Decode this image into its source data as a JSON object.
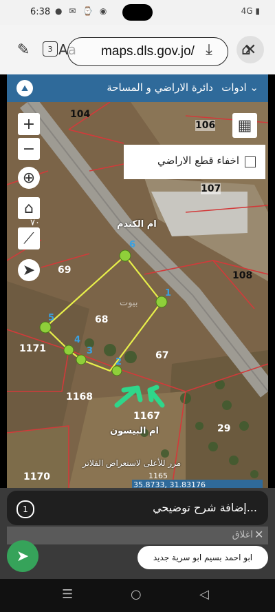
{
  "status": {
    "time": "6:38",
    "icons": "● ✉ ⌚ ◉",
    "right": "4G ▮"
  },
  "toolbar": {
    "url": "maps.dls.gov.jo/",
    "text_size_label": "Aa",
    "tab_count": "3"
  },
  "header": {
    "title": "دائرة الاراضي و المساحة",
    "tools": "ادوات ⌄"
  },
  "map": {
    "hide_parcels_label": "اخفاء قطع الاراضي",
    "parcels": [
      "104",
      "106",
      "107",
      "108",
      "69",
      "68",
      "67",
      "1171",
      "1168",
      "1167",
      "29",
      "1170",
      "٧٠"
    ],
    "vertices": [
      "1",
      "2",
      "3",
      "4",
      "5",
      "6"
    ],
    "streets": [
      "ام الكندم",
      "ام البيسون"
    ],
    "scroll_hint": "مرر للأعلى لاستعراض الفلاتر",
    "watermark": "بيوت",
    "coord_readout": "35.8733, 31.83176",
    "parcel_partial": "1165"
  },
  "caption": {
    "placeholder": "إضافة شرح توضيحي..."
  },
  "close": {
    "label": "اغلاق"
  },
  "toast": {
    "text": "ابو احمد بسيم ابو سرية جديد"
  },
  "nav": {
    "menu": "☰",
    "home": "○",
    "back": "◁"
  }
}
